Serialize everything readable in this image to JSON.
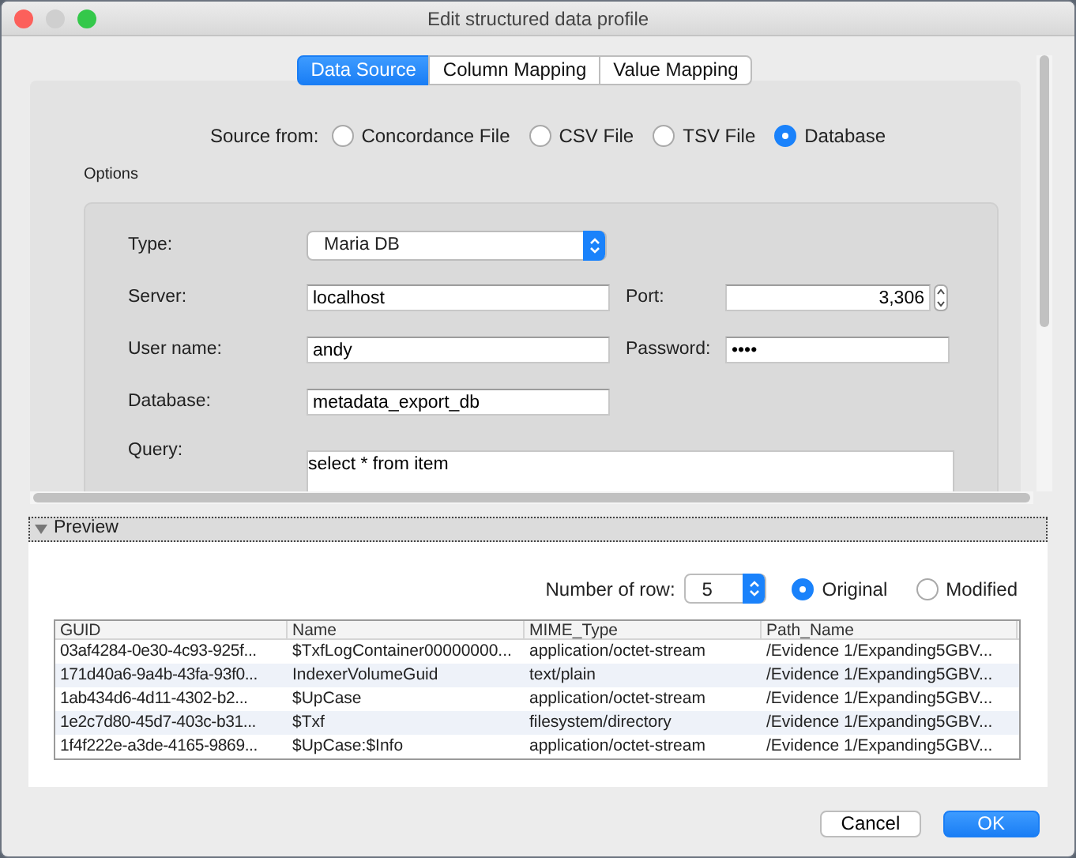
{
  "window": {
    "title": "Edit structured data profile"
  },
  "tabs": [
    {
      "label": "Data Source",
      "selected": true
    },
    {
      "label": "Column Mapping",
      "selected": false
    },
    {
      "label": "Value Mapping",
      "selected": false
    }
  ],
  "source": {
    "label": "Source from:",
    "options": [
      {
        "label": "Concordance File",
        "selected": false
      },
      {
        "label": "CSV File",
        "selected": false
      },
      {
        "label": "TSV File",
        "selected": false
      },
      {
        "label": "Database",
        "selected": true
      }
    ]
  },
  "options": {
    "title": "Options",
    "rows": [
      {
        "fields": [
          {
            "label": "Type:",
            "kind": "select",
            "value": "Maria DB"
          }
        ]
      },
      {
        "fields": [
          {
            "label": "Server:",
            "kind": "text",
            "value": "localhost"
          },
          {
            "label": "Port:",
            "kind": "spinner",
            "value": "3,306"
          }
        ]
      },
      {
        "fields": [
          {
            "label": "User name:",
            "kind": "text",
            "value": "andy"
          },
          {
            "label": "Password:",
            "kind": "password",
            "value": "••••"
          }
        ]
      },
      {
        "fields": [
          {
            "label": "Database:",
            "kind": "text",
            "value": "metadata_export_db"
          }
        ]
      },
      {
        "fields": [
          {
            "label": "Query:",
            "kind": "textarea",
            "value": "select * from item"
          }
        ]
      }
    ]
  },
  "preview": {
    "title": "Preview",
    "expanded": true,
    "row_count": {
      "label": "Number of row:",
      "value": "5"
    },
    "view_options": [
      {
        "label": "Original",
        "selected": true
      },
      {
        "label": "Modified",
        "selected": false
      }
    ],
    "table": {
      "columns": [
        "GUID",
        "Name",
        "MIME_Type",
        "Path_Name"
      ],
      "rows": [
        [
          "03af4284-0e30-4c93-925f...",
          "$TxfLogContainer00000000...",
          "application/octet-stream",
          "/Evidence 1/Expanding5GBV..."
        ],
        [
          "171d40a6-9a4b-43fa-93f0...",
          "IndexerVolumeGuid",
          "text/plain",
          "/Evidence 1/Expanding5GBV..."
        ],
        [
          "1ab434d6-4d11-4302-b2...",
          "$UpCase",
          "application/octet-stream",
          "/Evidence 1/Expanding5GBV..."
        ],
        [
          "1e2c7d80-45d7-403c-b31...",
          "$Txf",
          "filesystem/directory",
          "/Evidence 1/Expanding5GBV..."
        ],
        [
          "1f4f222e-a3de-4165-9869...",
          "$UpCase:$Info",
          "application/octet-stream",
          "/Evidence 1/Expanding5GBV..."
        ]
      ]
    }
  },
  "buttons": [
    {
      "label": "Cancel",
      "kind": "default"
    },
    {
      "label": "OK",
      "kind": "primary"
    }
  ]
}
